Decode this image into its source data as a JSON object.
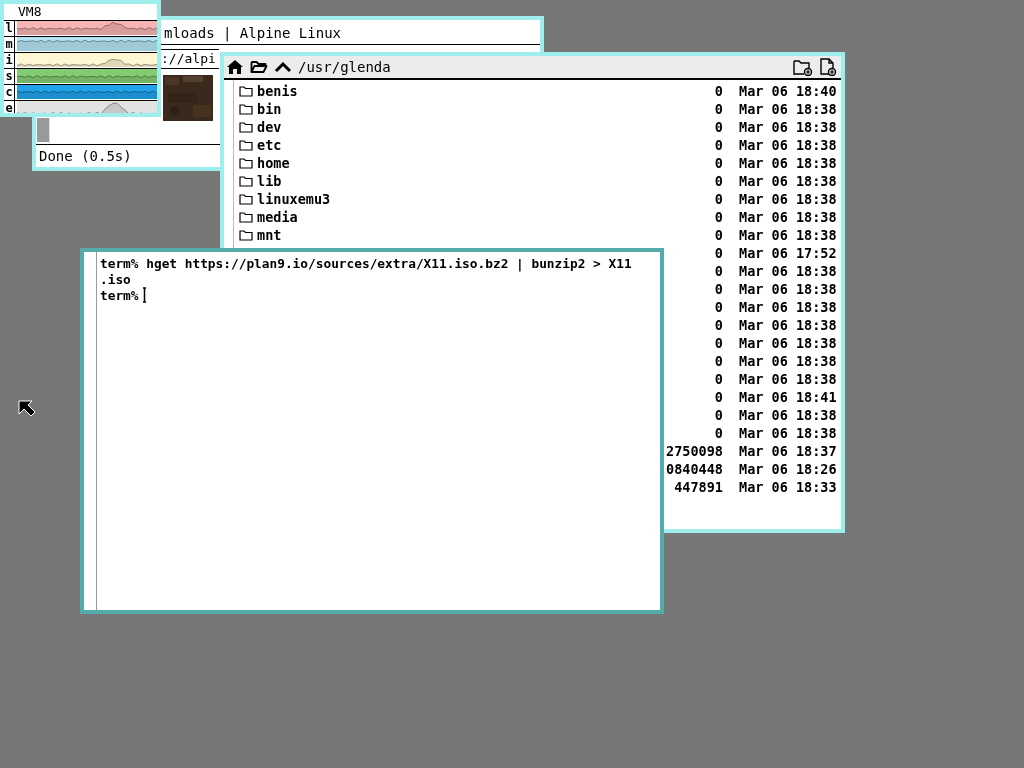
{
  "stats_window": {
    "title": "VM8",
    "active": false,
    "meters": [
      {
        "label": "l",
        "color": "#f6b4b4"
      },
      {
        "label": "m",
        "color": "#b4e4f4"
      },
      {
        "label": "i",
        "color": "#fff6d2"
      },
      {
        "label": "s",
        "color": "#84cc74"
      },
      {
        "label": "c",
        "color": "#22a2ea"
      },
      {
        "label": "e",
        "color": "#e2e2e2"
      }
    ]
  },
  "browser_window": {
    "title": "mloads | Alpine Linux",
    "url": "://alpi",
    "status": "Done (0.5s)",
    "active": false
  },
  "file_window": {
    "path": "/usr/glenda",
    "active": false,
    "rows": [
      {
        "name": "benis",
        "size": "0",
        "date": "Mar 06 18:40"
      },
      {
        "name": "bin",
        "size": "0",
        "date": "Mar 06 18:38"
      },
      {
        "name": "dev",
        "size": "0",
        "date": "Mar 06 18:38"
      },
      {
        "name": "etc",
        "size": "0",
        "date": "Mar 06 18:38"
      },
      {
        "name": "home",
        "size": "0",
        "date": "Mar 06 18:38"
      },
      {
        "name": "lib",
        "size": "0",
        "date": "Mar 06 18:38"
      },
      {
        "name": "linuxemu3",
        "size": "0",
        "date": "Mar 06 18:38"
      },
      {
        "name": "media",
        "size": "0",
        "date": "Mar 06 18:38"
      },
      {
        "name": "mnt",
        "size": "0",
        "date": "Mar 06 18:38"
      },
      {
        "size": "0",
        "date": "Mar 06 17:52"
      },
      {
        "size": "0",
        "date": "Mar 06 18:38"
      },
      {
        "size": "0",
        "date": "Mar 06 18:38"
      },
      {
        "size": "0",
        "date": "Mar 06 18:38"
      },
      {
        "size": "0",
        "date": "Mar 06 18:38"
      },
      {
        "size": "0",
        "date": "Mar 06 18:38"
      },
      {
        "size": "0",
        "date": "Mar 06 18:38"
      },
      {
        "size": "0",
        "date": "Mar 06 18:38"
      },
      {
        "size": "0",
        "date": "Mar 06 18:41"
      },
      {
        "size": "0",
        "date": "Mar 06 18:38"
      },
      {
        "size": "0",
        "date": "Mar 06 18:38"
      },
      {
        "size": "2750098",
        "date": "Mar 06 18:37"
      },
      {
        "size": "0840448",
        "date": "Mar 06 18:26"
      },
      {
        "size": "447891",
        "date": "Mar 06 18:33"
      }
    ]
  },
  "terminal_window": {
    "active": true,
    "lines": [
      "term% hget https://plan9.io/sources/extra/X11.iso.bz2 | bunzip2 > X11",
      ".iso",
      "term%"
    ]
  }
}
